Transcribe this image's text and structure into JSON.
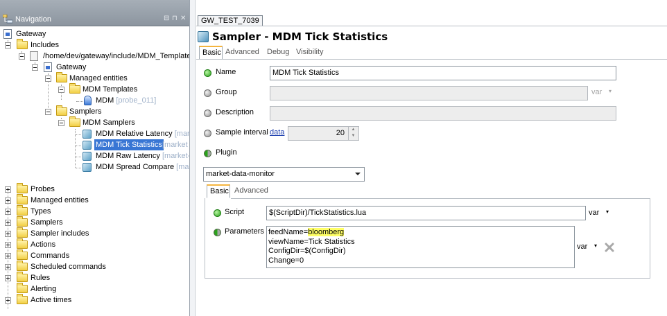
{
  "navigation": {
    "title": "Navigation",
    "controls": {
      "minimize": "⊟",
      "pin": "⊓",
      "close": "✕"
    },
    "tree": [
      {
        "label": "Gateway",
        "icon": "gateway-doc-icon"
      },
      {
        "label": "Includes",
        "icon": "folder-icon"
      },
      {
        "label": "/home/dev/gateway/include/MDM_Template",
        "icon": "file-icon"
      },
      {
        "label": "Gateway",
        "icon": "gateway-doc-icon"
      },
      {
        "label": "Managed entities",
        "icon": "folder-icon"
      },
      {
        "label": "MDM Templates",
        "icon": "folder-icon"
      },
      {
        "label": "MDM",
        "extra": "[probe_011]",
        "icon": "probe-icon"
      },
      {
        "label": "Samplers",
        "icon": "folder-icon"
      },
      {
        "label": "MDM Samplers",
        "icon": "folder-icon"
      },
      {
        "label": "MDM Relative Latency",
        "extra": "[mar",
        "icon": "sampler-icon"
      },
      {
        "label": "MDM Tick Statistics",
        "extra": "[market",
        "icon": "sampler-icon",
        "selected": true
      },
      {
        "label": "MDM Raw Latency",
        "extra": "[market-",
        "icon": "sampler-icon"
      },
      {
        "label": "MDM Spread Compare",
        "extra": "[mar",
        "icon": "sampler-icon"
      },
      {
        "label": "Probes",
        "icon": "folder-icon"
      },
      {
        "label": "Managed entities",
        "icon": "folder-icon"
      },
      {
        "label": "Types",
        "icon": "folder-icon"
      },
      {
        "label": "Samplers",
        "icon": "folder-icon"
      },
      {
        "label": "Sampler includes",
        "icon": "folder-icon"
      },
      {
        "label": "Actions",
        "icon": "folder-icon"
      },
      {
        "label": "Commands",
        "icon": "folder-icon"
      },
      {
        "label": "Scheduled commands",
        "icon": "folder-icon"
      },
      {
        "label": "Rules",
        "icon": "folder-icon"
      },
      {
        "label": "Alerting",
        "icon": "folder-icon"
      },
      {
        "label": "Active times",
        "icon": "folder-icon"
      }
    ]
  },
  "document_tab": "GW_TEST_7039",
  "page": {
    "title": "Sampler - MDM Tick Statistics",
    "tabs": [
      "Basic",
      "Advanced",
      "Debug",
      "Visibility"
    ],
    "active_tab": "Basic"
  },
  "form": {
    "name_label": "Name",
    "name_value": "MDM Tick Statistics",
    "group_label": "Group",
    "group_value": "",
    "group_var": "var",
    "description_label": "Description",
    "description_value": "",
    "sample_interval_label": "Sample interval",
    "sample_interval_link": "data",
    "sample_interval_value": "20",
    "plugin_label": "Plugin",
    "plugin_value": "market-data-monitor"
  },
  "plugin": {
    "tabs": [
      "Basic",
      "Advanced"
    ],
    "active_tab": "Basic",
    "script_label": "Script",
    "script_value": "$(ScriptDir)/TickStatistics.lua",
    "script_var": "var",
    "parameters_label": "Parameters",
    "parameters_lines": {
      "line1_key": "feedName=",
      "line1_value": "bloomberg",
      "line2": "viewName=Tick Statistics",
      "line3": "ConfigDir=$(ConfigDir)",
      "line4": "Change=0"
    },
    "parameters_var": "var"
  },
  "colors": {
    "accent_tab": "#f5b53f",
    "selection": "#3876d4",
    "status_green": "#2aa21b",
    "highlight": "#ffff66"
  }
}
